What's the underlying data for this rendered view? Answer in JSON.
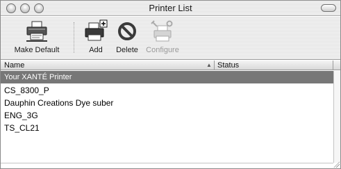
{
  "window": {
    "title": "Printer List"
  },
  "toolbar": {
    "make_default_label": "Make Default",
    "add_label": "Add",
    "delete_label": "Delete",
    "configure_label": "Configure"
  },
  "table": {
    "columns": [
      {
        "label": "Name"
      },
      {
        "label": "Status"
      }
    ],
    "rows": [
      {
        "name": "Your XANTÉ Printer",
        "status": "",
        "selected": true
      },
      {
        "name": "CS_8300_P",
        "status": ""
      },
      {
        "name": "Dauphin Creations Dye suber",
        "status": ""
      },
      {
        "name": "ENG_3G",
        "status": ""
      },
      {
        "name": "TS_CL21",
        "status": ""
      }
    ]
  },
  "colors": {
    "selection": "#777777",
    "disabled_text": "#9a9a9a"
  }
}
